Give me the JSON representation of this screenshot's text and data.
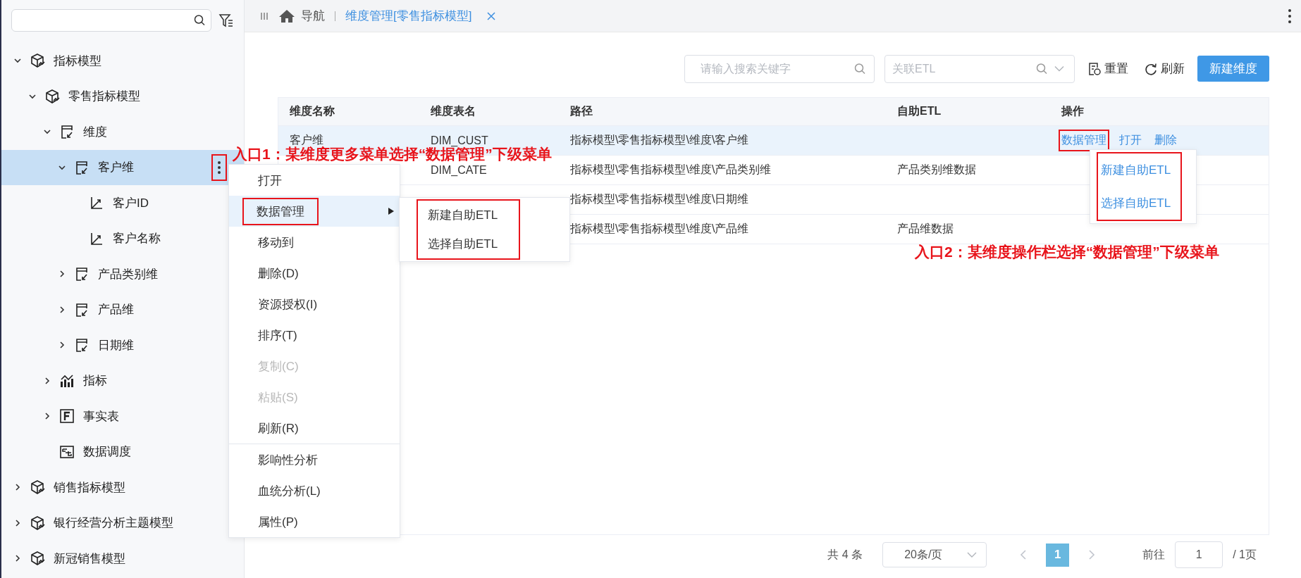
{
  "sidebar": {
    "tree": [
      {
        "label": "指标模型",
        "kind": "model",
        "expanded": true,
        "selected": false,
        "children": [
          {
            "label": "零售指标模型",
            "kind": "model",
            "expanded": true,
            "selected": false,
            "children": [
              {
                "label": "维度",
                "kind": "dimension",
                "expanded": true,
                "selected": false,
                "children": [
                  {
                    "label": "客户维",
                    "kind": "dimension",
                    "expanded": true,
                    "selected": true,
                    "children": [
                      {
                        "label": "客户ID",
                        "kind": "attribute",
                        "selected": false
                      },
                      {
                        "label": "客户名称",
                        "kind": "attribute",
                        "selected": false
                      }
                    ]
                  },
                  {
                    "label": "产品类别维",
                    "kind": "dimension",
                    "expanded": false,
                    "selected": false
                  },
                  {
                    "label": "产品维",
                    "kind": "dimension",
                    "expanded": false,
                    "selected": false
                  },
                  {
                    "label": "日期维",
                    "kind": "dimension",
                    "expanded": false,
                    "selected": false
                  }
                ]
              },
              {
                "label": "指标",
                "kind": "metric",
                "expanded": false,
                "selected": false
              },
              {
                "label": "事实表",
                "kind": "fact",
                "expanded": false,
                "selected": false
              },
              {
                "label": "数据调度",
                "kind": "schedule",
                "selected": false
              }
            ]
          }
        ]
      },
      {
        "label": "销售指标模型",
        "kind": "model",
        "expanded": false,
        "selected": false
      },
      {
        "label": "银行经营分析主题模型",
        "kind": "model",
        "expanded": false,
        "selected": false
      },
      {
        "label": "新冠销售模型",
        "kind": "model",
        "expanded": false,
        "selected": false
      }
    ]
  },
  "tabs": [
    {
      "label": "导航",
      "kind": "home",
      "selected": false
    },
    {
      "label": "维度管理[零售指标模型]",
      "kind": "page",
      "selected": true
    }
  ],
  "toolbar": {
    "search": {
      "placeholder": "请输入搜索关键字"
    },
    "etl_filter": {
      "placeholder": "关联ETL"
    },
    "buttons": [
      {
        "label": "重置",
        "kind": "reset"
      },
      {
        "label": "刷新",
        "kind": "refresh"
      },
      {
        "label": "新建维度",
        "kind": "primary"
      }
    ]
  },
  "table": {
    "columns": [
      "维度名称",
      "维度表名",
      "路径",
      "自助ETL",
      "操作"
    ],
    "rows": [
      {
        "name": "客户维",
        "table_name": "DIM_CUST",
        "path": "指标模型\\零售指标模型\\维度\\客户维",
        "selected": true,
        "actions": [
          {
            "label": "数据管理",
            "annotated": true
          },
          {
            "label": "打开",
            "annotated": false
          },
          {
            "label": "删除",
            "annotated": false
          }
        ]
      },
      {
        "table_name": "DIM_CATE",
        "path": "指标模型\\零售指标模型\\维度\\产品类别维",
        "etl": "产品类别维数据",
        "selected": false
      },
      {
        "path": "指标模型\\零售指标模型\\维度\\日期维",
        "selected": false
      },
      {
        "path": "指标模型\\零售指标模型\\维度\\产品维",
        "etl": "产品维数据",
        "selected": false
      }
    ]
  },
  "row_menu": {
    "annotated": true,
    "items": [
      {
        "label": "新建自助ETL"
      },
      {
        "label": "选择自助ETL"
      }
    ]
  },
  "context_menu": {
    "trigger_annotated": true,
    "groups": [
      [
        {
          "label": "打开",
          "disabled": false,
          "selected": false,
          "submenu": false,
          "annotated": false
        },
        {
          "label": "数据管理",
          "disabled": false,
          "selected": true,
          "submenu": true,
          "annotated": true
        },
        {
          "label": "移动到",
          "disabled": false,
          "selected": false,
          "submenu": false,
          "annotated": false
        },
        {
          "label": "删除(D)",
          "disabled": false,
          "selected": false,
          "submenu": false,
          "annotated": false
        },
        {
          "label": "资源授权(I)",
          "disabled": false,
          "selected": false,
          "submenu": false,
          "annotated": false
        },
        {
          "label": "排序(T)",
          "disabled": false,
          "selected": false,
          "submenu": false,
          "annotated": false
        },
        {
          "label": "复制(C)",
          "disabled": true,
          "selected": false,
          "submenu": false,
          "annotated": false
        },
        {
          "label": "粘贴(S)",
          "disabled": true,
          "selected": false,
          "submenu": false,
          "annotated": false
        },
        {
          "label": "刷新(R)",
          "disabled": false,
          "selected": false,
          "submenu": false,
          "annotated": false
        }
      ],
      [
        {
          "label": "影响性分析",
          "disabled": false,
          "selected": false,
          "submenu": false,
          "annotated": false
        },
        {
          "label": "血统分析(L)",
          "disabled": false,
          "selected": false,
          "submenu": false,
          "annotated": false
        },
        {
          "label": "属性(P)",
          "disabled": false,
          "selected": false,
          "submenu": false,
          "annotated": false
        }
      ]
    ],
    "submenu": {
      "annotated": true,
      "items": [
        {
          "label": "新建自助ETL"
        },
        {
          "label": "选择自助ETL"
        }
      ]
    }
  },
  "annotations": [
    {
      "text": "入口1：某维度更多菜单选择“数据管理”下级菜单"
    },
    {
      "text": "入口2：某维度操作栏选择“数据管理”下级菜单"
    }
  ],
  "pagination": {
    "total": "共 4 条",
    "page_size": "20条/页",
    "pages": [
      {
        "label": "1",
        "selected": true
      }
    ],
    "goto_label": "前往",
    "goto_value": "1",
    "page_count": "/ 1页"
  }
}
